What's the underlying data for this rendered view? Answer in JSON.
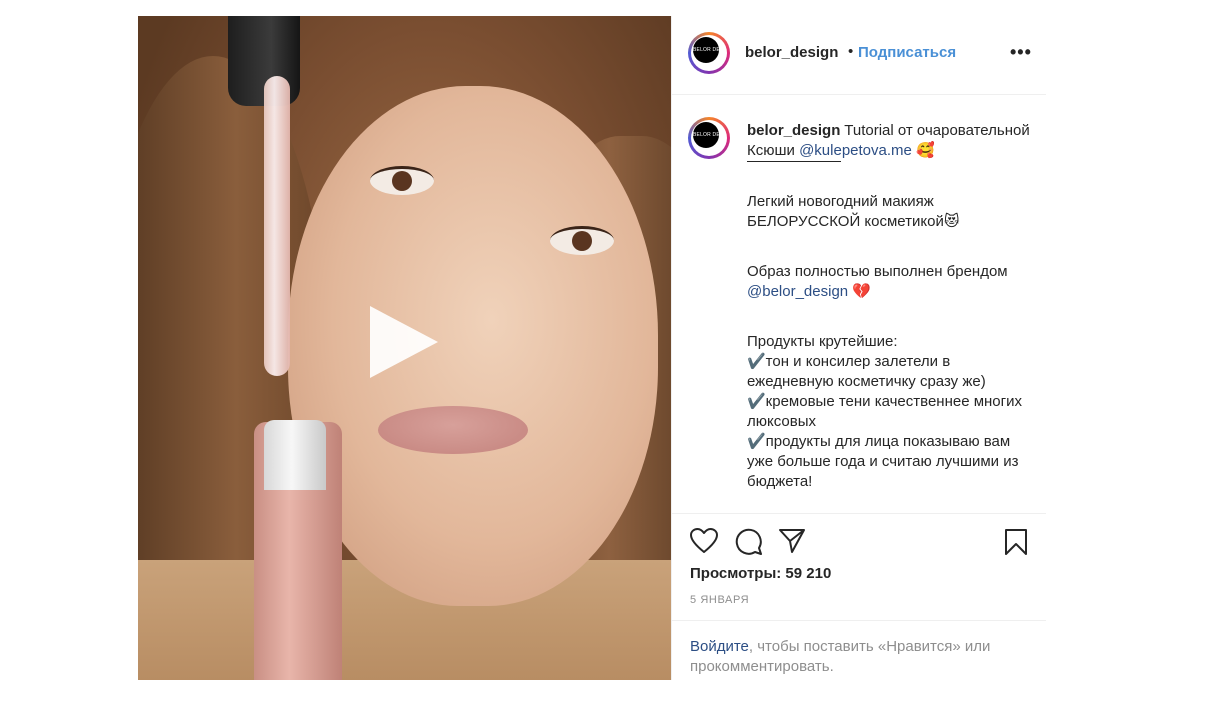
{
  "account": {
    "username": "belor_design",
    "avatar_text": "BELOR DESIGN"
  },
  "header": {
    "dot": "•",
    "follow_label": "Подписаться",
    "more_label": "•••"
  },
  "caption": {
    "username": "belor_design",
    "intro": " Tutorial от очаровательной Ксюши ",
    "mention1": "@kulepetova.me",
    "emoji1": " 🥰",
    "para1": "Легкий новогодний макияж БЕЛОРУССКОЙ косметикой😻",
    "para2_text": "Образ полностью выполнен брендом ",
    "mention2": "@belor_design",
    "emoji2": " 💔",
    "products_heading": "Продукты крутейшие:",
    "products": [
      "✔️тон и консилер залетели в ежедневную косметичку сразу же)",
      "✔️кремовые тени качественнее многих люксовых",
      "✔️продукты для лица показываю вам уже больше года и считаю лучшими из бюджета!"
    ]
  },
  "actions": {
    "icons": [
      "heart-icon",
      "comment-icon",
      "share-icon",
      "bookmark-icon"
    ],
    "views": "Просмотры: 59 210",
    "date": "5 ЯНВАРЯ",
    "login_link": "Войдите",
    "login_rest": ", чтобы поставить «Нравится» или прокомментировать."
  },
  "colors": {
    "link_blue": "#4a90d6",
    "mention_blue": "#2c4e84",
    "text": "#262626",
    "muted": "#8e8e8e"
  }
}
